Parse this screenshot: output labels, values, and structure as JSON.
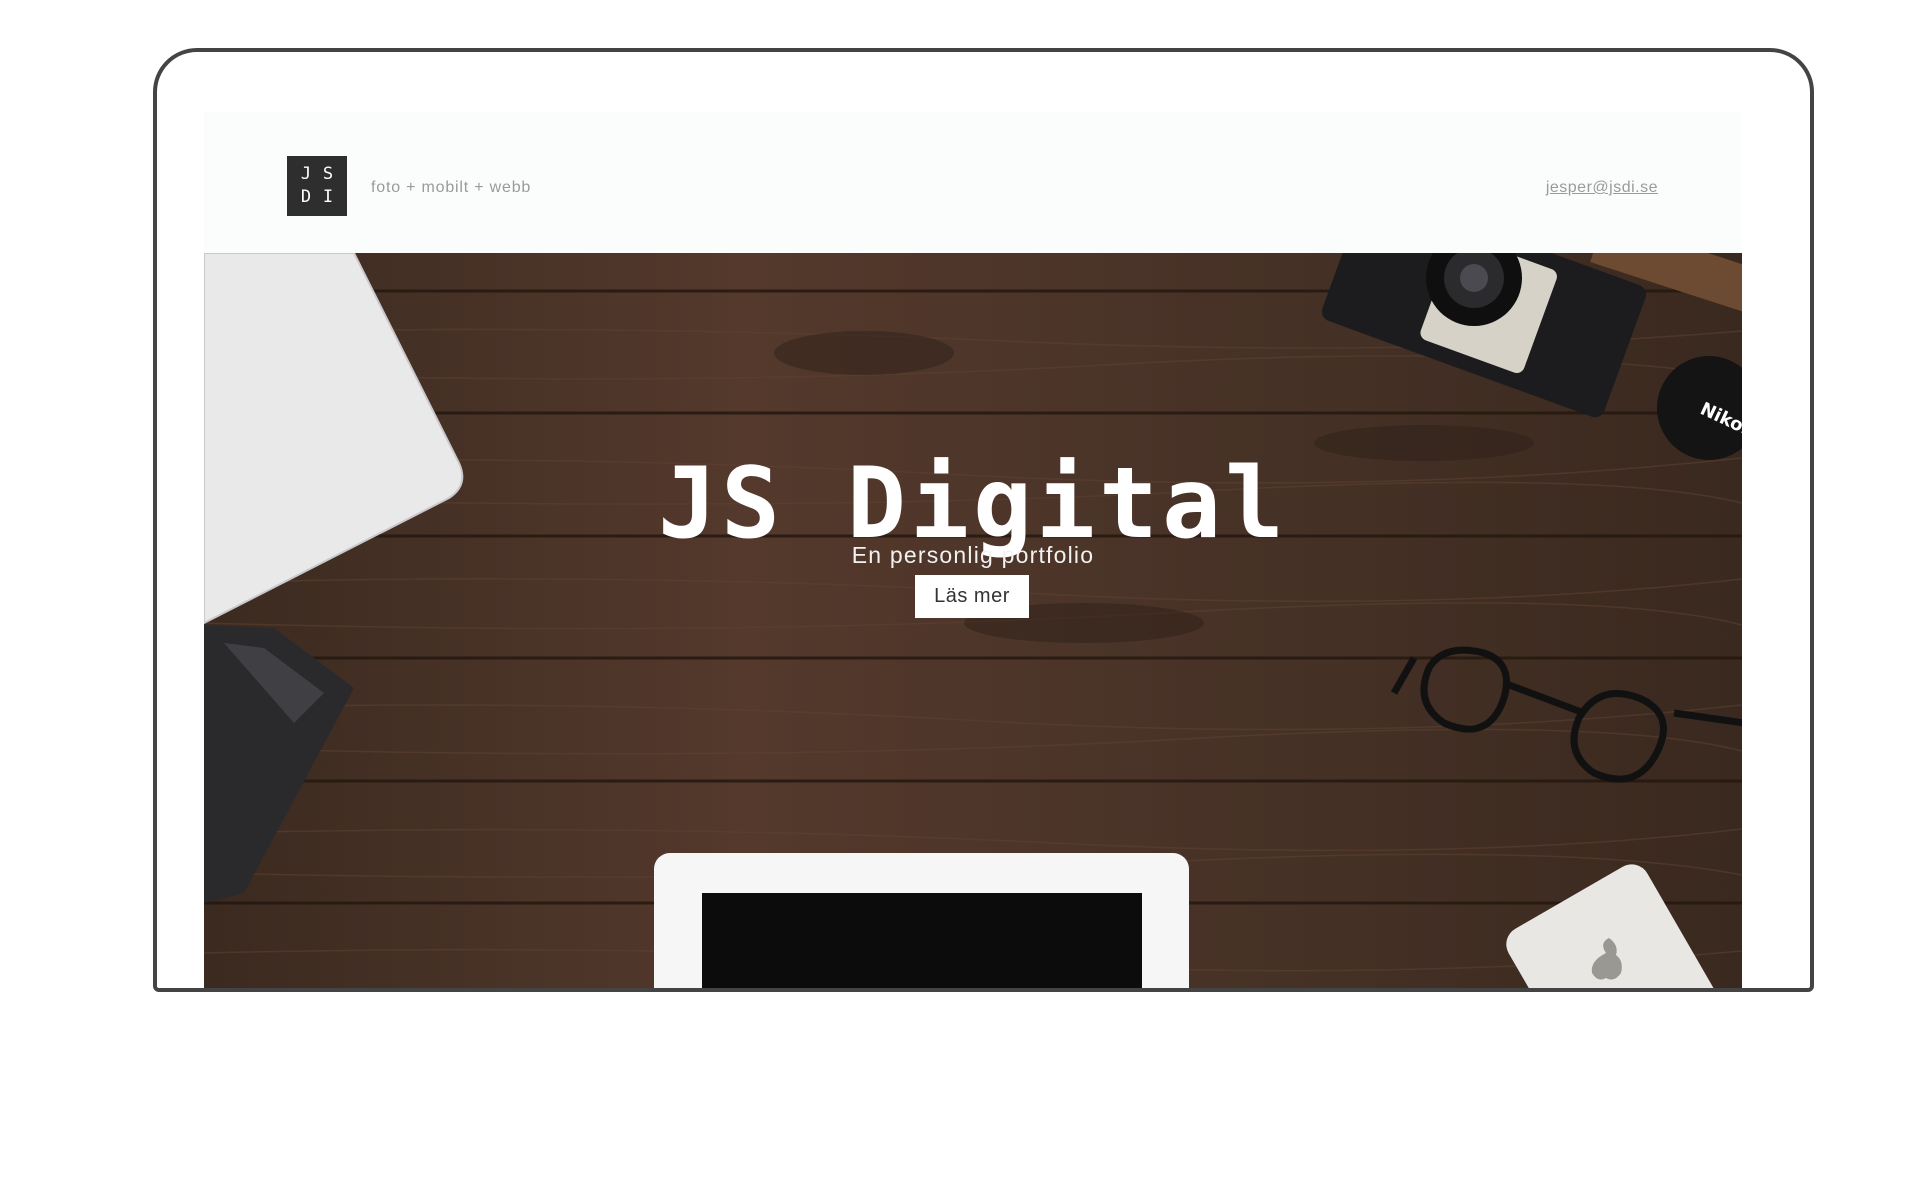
{
  "header": {
    "logo_letters": [
      "J",
      "S",
      "D",
      "I"
    ],
    "tagline": "foto + mobilt + webb",
    "email": "jesper@jsdi.se"
  },
  "hero": {
    "title": "JS Digital",
    "subtitle": "En personlig portfolio",
    "button_label": "Läs mer",
    "camera_brand": "Nikon"
  },
  "colors": {
    "wood": "#4a3328",
    "logo_bg": "#2e2e2e",
    "header_bg": "#fbfdfc",
    "frame": "#444444"
  }
}
